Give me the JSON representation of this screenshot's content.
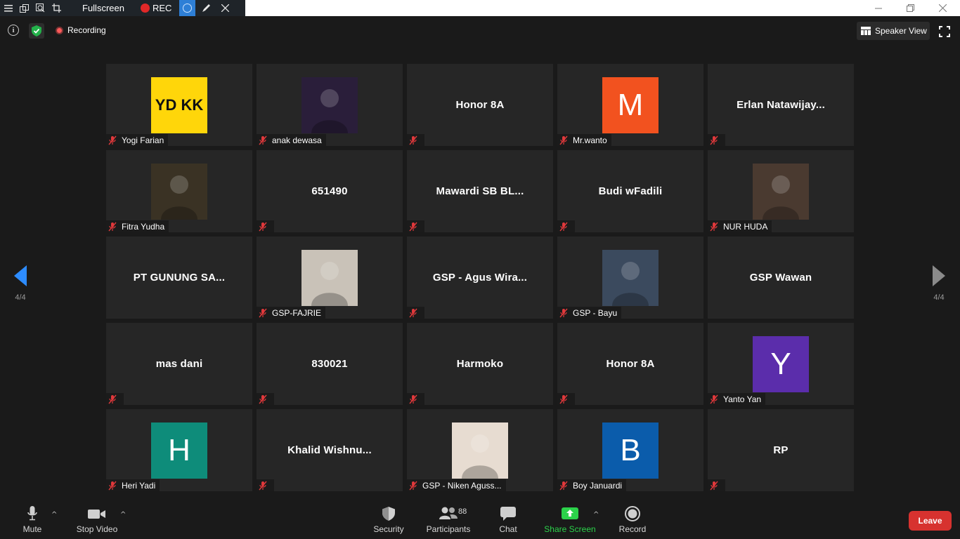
{
  "titlebar": {
    "fullscreen_label": "Fullscreen",
    "rec_label": "REC",
    "icons": [
      "menu-icon",
      "window-icon",
      "zoom-search-icon",
      "crop-icon",
      "pen-icon",
      "close-icon"
    ]
  },
  "infobar": {
    "recording_label": "Recording",
    "speaker_view_label": "Speaker View"
  },
  "pager": {
    "left": "4/4",
    "right": "4/4"
  },
  "participants": [
    {
      "name": "Yogi Farian",
      "display": "",
      "avatar_type": "text-logo",
      "avatar_text": "YD KK",
      "avatar_color": "#ffd60a"
    },
    {
      "name": "anak dewasa",
      "display": "",
      "avatar_type": "photo",
      "avatar_color": "#2a1e3a"
    },
    {
      "name": "",
      "display": "Honor 8A",
      "avatar_type": "none"
    },
    {
      "name": "Mr.wanto",
      "display": "",
      "avatar_type": "letter",
      "avatar_text": "M",
      "avatar_color": "#f2521f"
    },
    {
      "name": "",
      "display": "Erlan  Natawijay...",
      "avatar_type": "none"
    },
    {
      "name": "Fitra Yudha",
      "display": "",
      "avatar_type": "photo",
      "avatar_color": "#3a3224"
    },
    {
      "name": "",
      "display": "651490",
      "avatar_type": "none"
    },
    {
      "name": "",
      "display": "Mawardi  SB  BL...",
      "avatar_type": "none"
    },
    {
      "name": "",
      "display": "Budi wFadili",
      "avatar_type": "none"
    },
    {
      "name": "NUR HUDA",
      "display": "",
      "avatar_type": "photo",
      "avatar_color": "#4a3a30"
    },
    {
      "name": "",
      "display": "PT GUNUNG SA...",
      "avatar_type": "none",
      "muted": false
    },
    {
      "name": "GSP-FAJRIE",
      "display": "",
      "avatar_type": "photo",
      "avatar_color": "#c9c2b8"
    },
    {
      "name": "",
      "display": "GSP  -  Agus  Wira...",
      "avatar_type": "none"
    },
    {
      "name": "GSP - Bayu",
      "display": "",
      "avatar_type": "photo",
      "avatar_color": "#3b4a5e"
    },
    {
      "name": "",
      "display": "GSP  Wawan",
      "avatar_type": "none",
      "muted": false
    },
    {
      "name": "",
      "display": "mas dani",
      "avatar_type": "none"
    },
    {
      "name": "",
      "display": "830021",
      "avatar_type": "none"
    },
    {
      "name": "",
      "display": "Harmoko",
      "avatar_type": "none"
    },
    {
      "name": "",
      "display": "Honor 8A",
      "avatar_type": "none"
    },
    {
      "name": "Yanto Yan",
      "display": "",
      "avatar_type": "letter",
      "avatar_text": "Y",
      "avatar_color": "#5b2dab"
    },
    {
      "name": "Heri Yadi",
      "display": "",
      "avatar_type": "letter",
      "avatar_text": "H",
      "avatar_color": "#0e8c7a"
    },
    {
      "name": "",
      "display": "Khalid  Wishnu...",
      "avatar_type": "none"
    },
    {
      "name": "GSP - Niken Aguss...",
      "display": "",
      "avatar_type": "photo",
      "avatar_color": "#e7dcd1"
    },
    {
      "name": "Boy Januardi",
      "display": "",
      "avatar_type": "letter",
      "avatar_text": "B",
      "avatar_color": "#0b5cab"
    },
    {
      "name": "",
      "display": "RP",
      "avatar_type": "none"
    }
  ],
  "toolbar": {
    "mute": "Mute",
    "stop_video": "Stop Video",
    "security": "Security",
    "participants": "Participants",
    "participants_count": "88",
    "chat": "Chat",
    "share_screen": "Share Screen",
    "record": "Record",
    "leave": "Leave"
  },
  "colors": {
    "background": "#1a1a1a",
    "tile": "#262626",
    "share_green": "#2bd24a",
    "leave_red": "#d7322f",
    "nav_blue": "#2d8cff",
    "mic_off_red": "#e0383b"
  }
}
